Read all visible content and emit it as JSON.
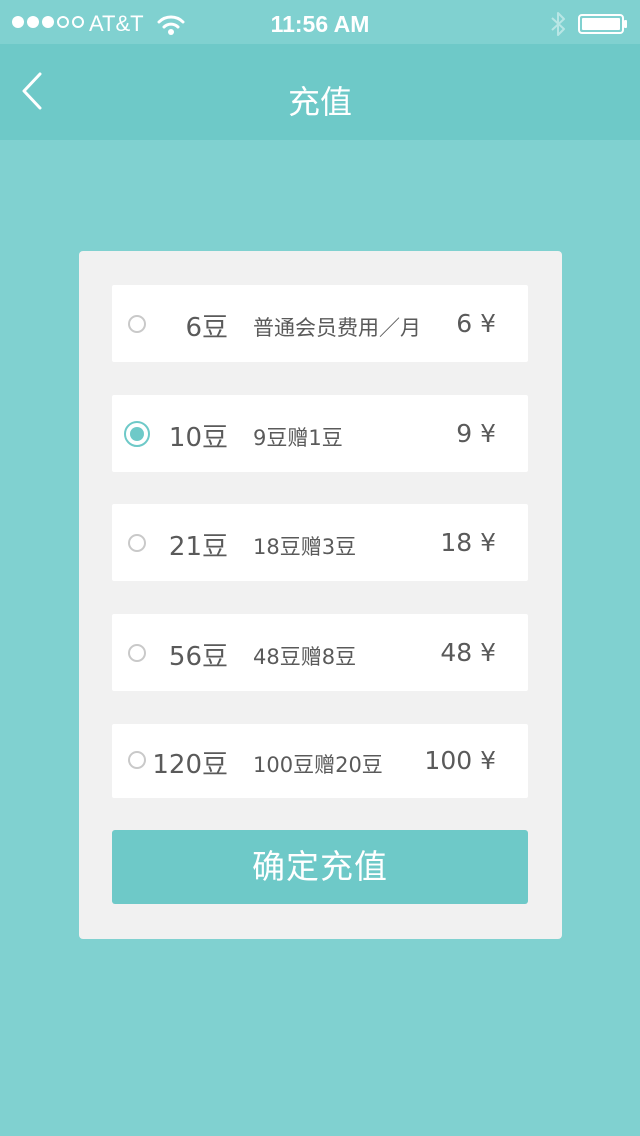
{
  "status_bar": {
    "carrier": "AT&T",
    "time": "11:56 AM",
    "signal_strength": 3,
    "signal_max": 5,
    "battery_level": 1.0
  },
  "nav": {
    "title": "充值",
    "back_icon": "chevron-left-icon"
  },
  "options": [
    {
      "amount": "6豆",
      "desc": "普通会员费用／月",
      "price": "6 ¥",
      "selected": false
    },
    {
      "amount": "10豆",
      "desc": "9豆赠1豆",
      "price": "9 ¥",
      "selected": true
    },
    {
      "amount": "21豆",
      "desc": "18豆赠3豆",
      "price": "18 ¥",
      "selected": false
    },
    {
      "amount": "56豆",
      "desc": "48豆赠8豆",
      "price": "48 ¥",
      "selected": false
    },
    {
      "amount": "120豆",
      "desc": "100豆赠20豆",
      "price": "100 ¥",
      "selected": false
    }
  ],
  "confirm_label": "确定充值",
  "colors": {
    "background": "#80d1d0",
    "nav_bar": "#6ec9c8",
    "accent": "#6ec9c8",
    "card": "#f1f1f1",
    "text": "#5a5a5a"
  }
}
